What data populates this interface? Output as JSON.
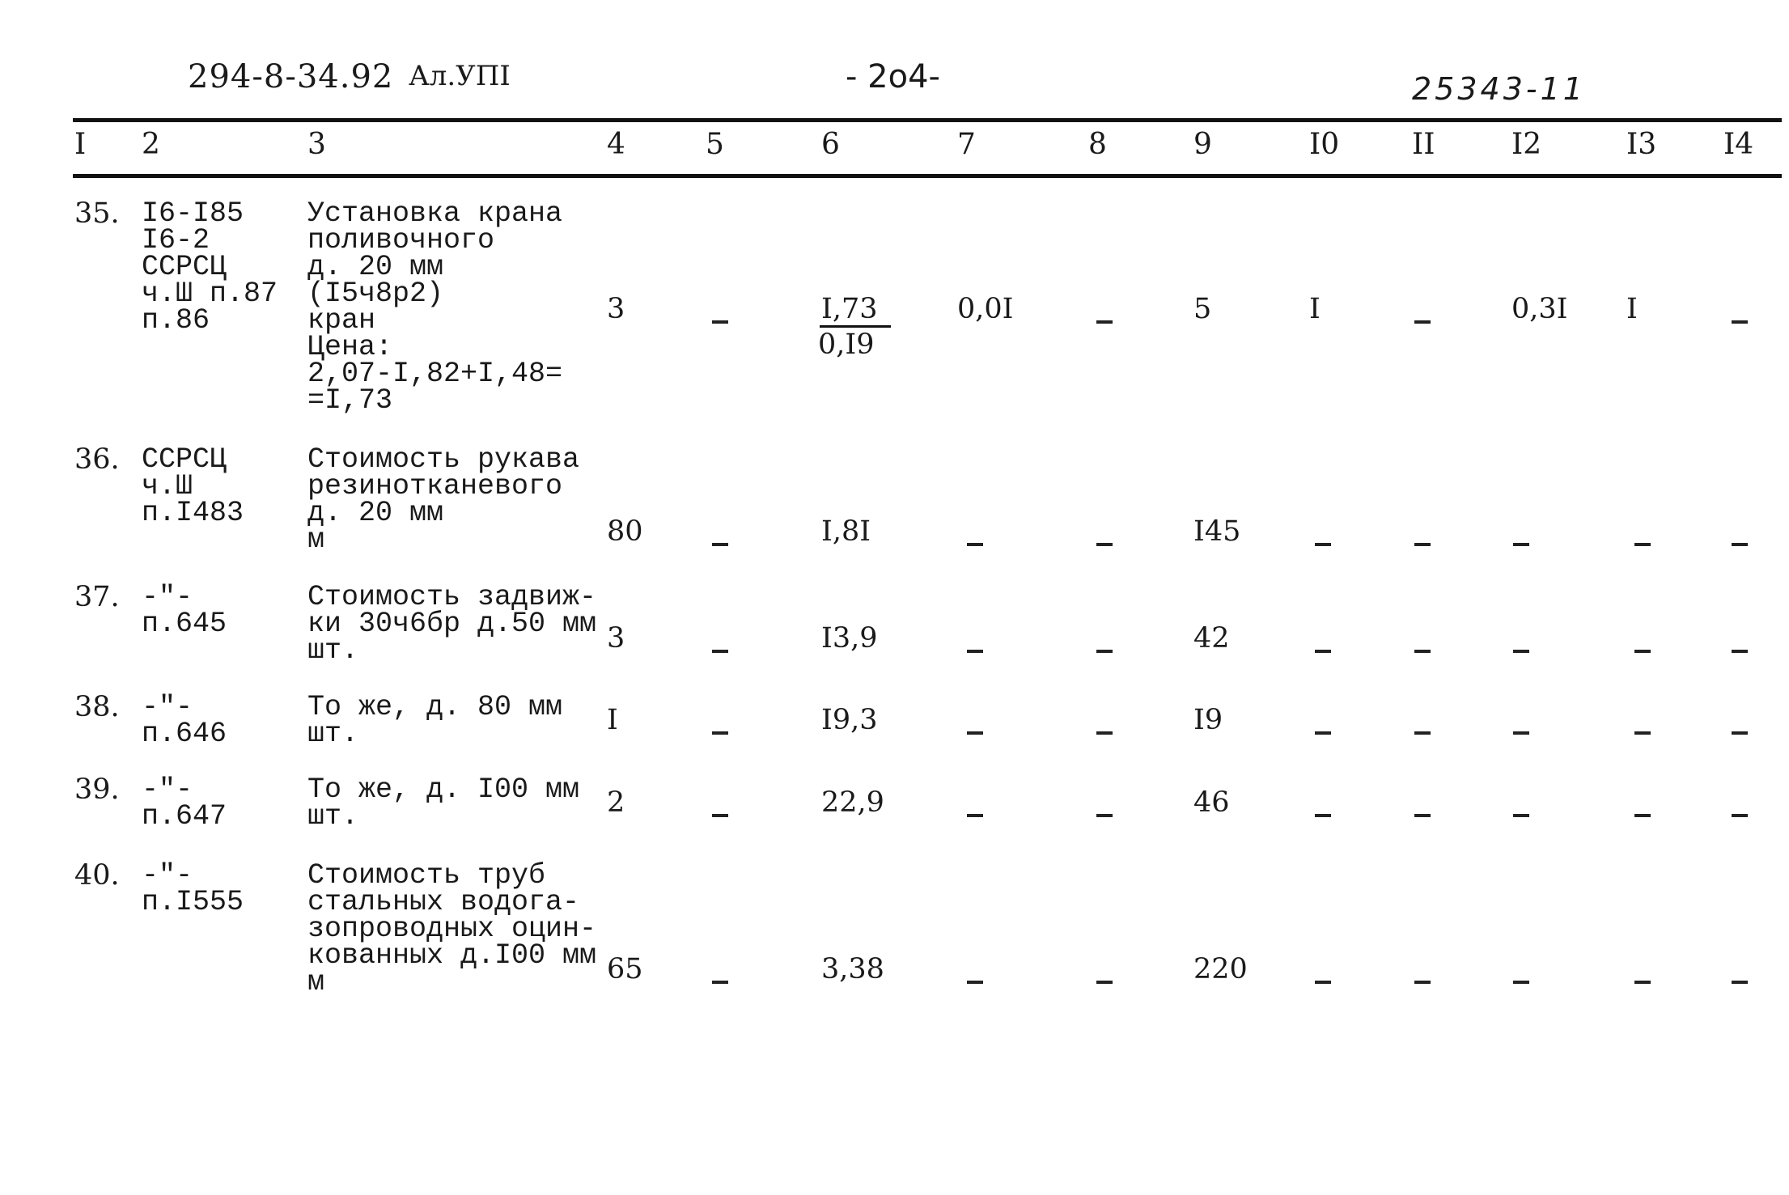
{
  "header": {
    "doc_code": "294-8-34.92",
    "album": "Ал.УПI",
    "page_number": "- 2o4-",
    "archive_number": "25343-11"
  },
  "columns": [
    "I",
    "2",
    "3",
    "4",
    "5",
    "6",
    "7",
    "8",
    "9",
    "I0",
    "II",
    "I2",
    "I3",
    "I4"
  ],
  "rows": [
    {
      "no": "35.",
      "ref": "I6-I85\nI6-2\nССРСЦ\nч.Ш п.87\nп.86",
      "desc": "Установка крана\nполивочного\nд. 20 мм\n(I5ч8р2)\nкран\nЦена:\n2,07-I,82+I,48=\n=I,73",
      "c4": "3",
      "c5": "-",
      "c6": "I,73",
      "c6_sub": "0,I9",
      "c7": "0,0I",
      "c8": "-",
      "c9": "5",
      "c10": "I",
      "c11": "-",
      "c12": "0,3I",
      "c13": "I",
      "c14": "-"
    },
    {
      "no": "36.",
      "ref": "ССРСЦ\nч.Ш\nп.I483",
      "desc": "Стоимость рукава\nрезинотканевого\nд. 20 мм\nм",
      "c4": "80",
      "c5": "-",
      "c6": "I,8I",
      "c7": "-",
      "c8": "-",
      "c9": "I45",
      "c10": "-",
      "c11": "-",
      "c12": "-",
      "c13": "-",
      "c14": "-"
    },
    {
      "no": "37.",
      "ref": "-\"-\nп.645",
      "desc": "Стоимость задвиж-\nки 30ч6бр д.50 мм\nшт.",
      "c4": "3",
      "c5": "-",
      "c6": "I3,9",
      "c7": "-",
      "c8": "-",
      "c9": "42",
      "c10": "-",
      "c11": "-",
      "c12": "-",
      "c13": "-",
      "c14": "-"
    },
    {
      "no": "38.",
      "ref": "-\"-\nп.646",
      "desc": "То же, д. 80 мм\nшт.",
      "c4": "I",
      "c5": "-",
      "c6": "I9,3",
      "c7": "-",
      "c8": "-",
      "c9": "I9",
      "c10": "-",
      "c11": "-",
      "c12": "-",
      "c13": "-",
      "c14": "-"
    },
    {
      "no": "39.",
      "ref": "-\"-\nп.647",
      "desc": "То же, д. I00 мм\nшт.",
      "c4": "2",
      "c5": "-",
      "c6": "22,9",
      "c7": "-",
      "c8": "-",
      "c9": "46",
      "c10": "-",
      "c11": "-",
      "c12": "-",
      "c13": "-",
      "c14": "-"
    },
    {
      "no": "40.",
      "ref": "-\"-\nп.I555",
      "desc": "Стоимость труб\nстальных водога-\nзопроводных оцин-\nкованных д.I00 мм\nм",
      "c4": "65",
      "c5": "-",
      "c6": "3,38",
      "c7": "-",
      "c8": "-",
      "c9": "220",
      "c10": "-",
      "c11": "-",
      "c12": "-",
      "c13": "-",
      "c14": "-"
    }
  ]
}
